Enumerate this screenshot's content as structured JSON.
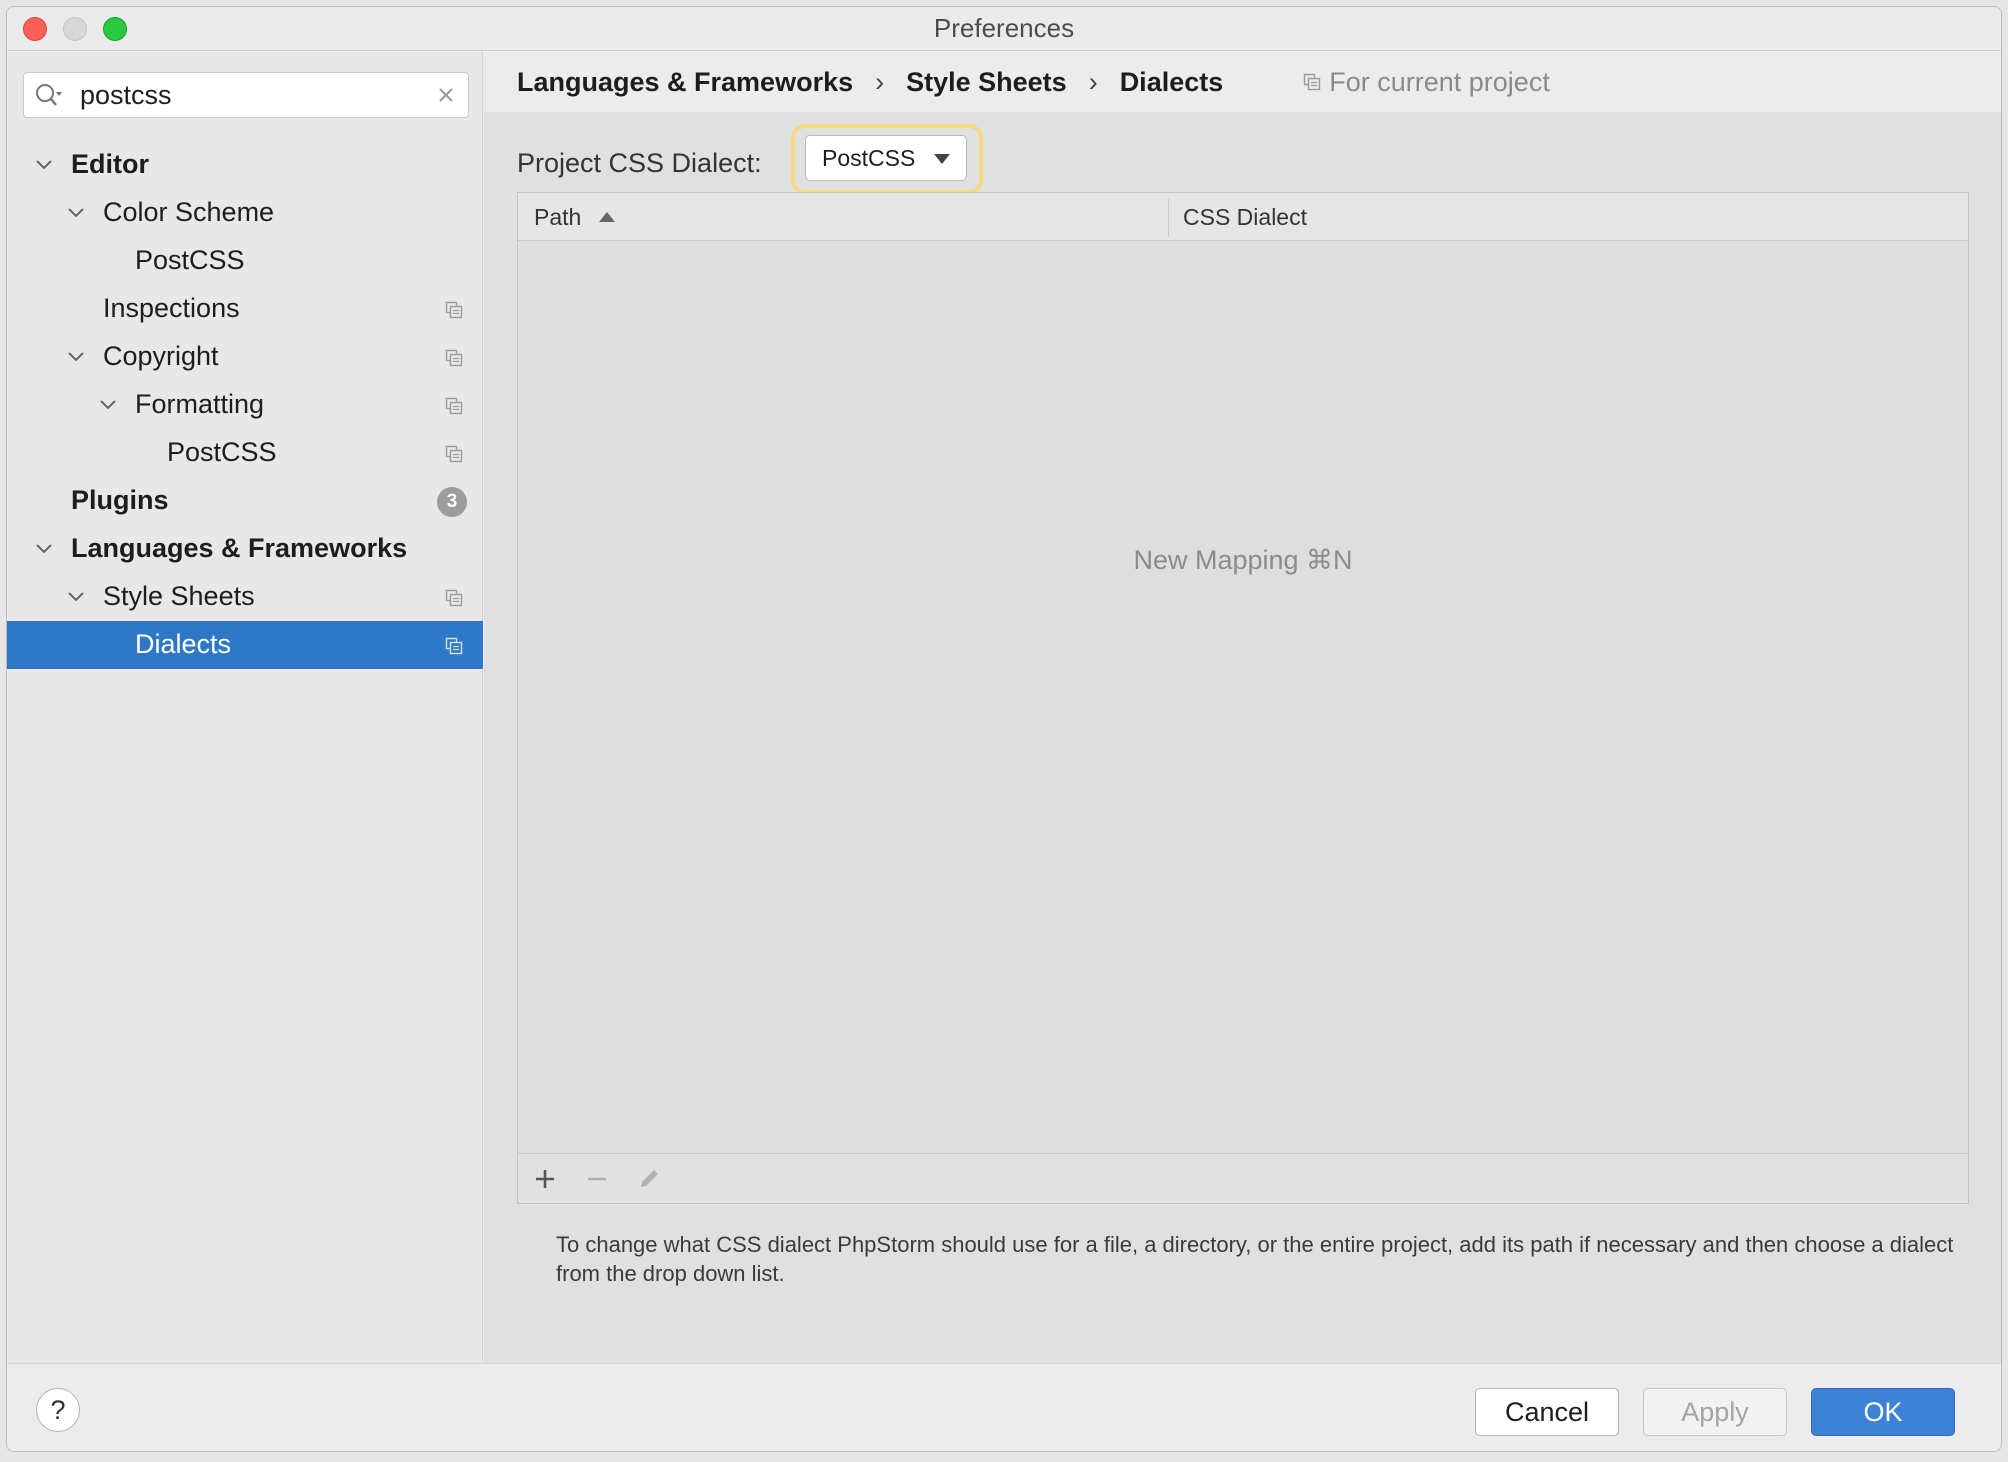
{
  "window": {
    "title": "Preferences"
  },
  "search": {
    "value": "postcss"
  },
  "tree": [
    {
      "label": "Editor",
      "level": 0,
      "bold": true,
      "expanded": true,
      "copy": false
    },
    {
      "label": "Color Scheme",
      "level": 1,
      "bold": false,
      "expanded": true,
      "copy": false
    },
    {
      "label": "PostCSS",
      "level": 2,
      "bold": false,
      "expanded": null,
      "copy": false
    },
    {
      "label": "Inspections",
      "level": 1,
      "bold": false,
      "expanded": null,
      "copy": true
    },
    {
      "label": "Copyright",
      "level": 1,
      "bold": false,
      "expanded": true,
      "copy": true
    },
    {
      "label": "Formatting",
      "level": 2,
      "bold": false,
      "expanded": true,
      "copy": true
    },
    {
      "label": "PostCSS",
      "level": 3,
      "bold": false,
      "expanded": null,
      "copy": true
    },
    {
      "label": "Plugins",
      "level": 0,
      "bold": true,
      "expanded": null,
      "copy": false,
      "badge": "3"
    },
    {
      "label": "Languages & Frameworks",
      "level": 0,
      "bold": true,
      "expanded": true,
      "copy": false
    },
    {
      "label": "Style Sheets",
      "level": 1,
      "bold": false,
      "expanded": true,
      "copy": true
    },
    {
      "label": "Dialects",
      "level": 2,
      "bold": false,
      "expanded": null,
      "copy": true,
      "selected": true
    }
  ],
  "breadcrumb": {
    "items": [
      "Languages & Frameworks",
      "Style Sheets",
      "Dialects"
    ],
    "separator": "›",
    "scope": "For current project"
  },
  "dialect": {
    "label": "Project CSS Dialect:",
    "selected": "PostCSS"
  },
  "table": {
    "columns": [
      "Path",
      "CSS Dialect"
    ],
    "empty_text": "New Mapping ⌘N"
  },
  "hint": "To change what CSS dialect PhpStorm should use for a file, a directory, or the entire project, add its path if necessary and then choose a dialect from the drop down list.",
  "footer": {
    "help": "?",
    "cancel": "Cancel",
    "apply": "Apply",
    "ok": "OK"
  },
  "colors": {
    "selection": "#2f78c8",
    "ok_button": "#3d82d4",
    "focus_ring": "#f5d982"
  }
}
